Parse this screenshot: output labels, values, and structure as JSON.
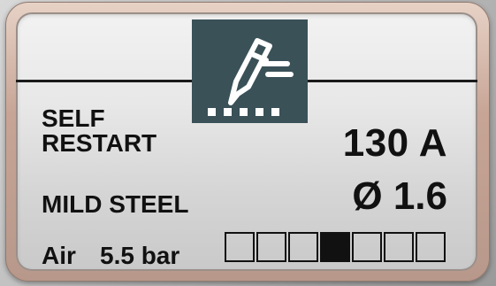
{
  "panel": {
    "mode_line1": "SELF",
    "mode_line2": "RESTART",
    "current": "130 A",
    "material": "MILD STEEL",
    "wire_size": "Ø 1.6",
    "gas": "Air",
    "pressure": "5.5 bar",
    "icon": "welding-torch-icon",
    "level": {
      "segments": 7,
      "active_index": 4
    }
  },
  "colors": {
    "icon_background": "#3a5158",
    "text": "#111111",
    "screen": "#e8e8e8"
  }
}
